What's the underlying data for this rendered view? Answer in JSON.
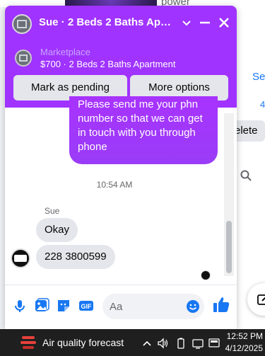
{
  "background": {
    "partial_text": "power",
    "see_link": "Se",
    "count_partial": "4",
    "delete_button": "elete"
  },
  "chat": {
    "title": "Sue · 2 Beds 2 Baths Apart…",
    "listing": {
      "source": "Marketplace",
      "title": "$700 · 2 Beds 2 Baths Apartment"
    },
    "buttons": {
      "mark_pending": "Mark as pending",
      "more_options": "More options"
    },
    "messages": {
      "sent_text": "Please send me your phn number so that we can get in touch with you through phone",
      "timestamp": "10:54 AM",
      "sender_name": "Sue",
      "received": [
        "Okay",
        "228 3800599"
      ]
    },
    "composer": {
      "placeholder": "Aa"
    },
    "colors": {
      "header": "#a033ff",
      "sent_bubble": "#a833ff",
      "accent_icons": "#1877f2"
    }
  },
  "taskbar": {
    "weather": "Air quality forecast",
    "time": "12:52 PM",
    "date": "4/12/2025"
  }
}
